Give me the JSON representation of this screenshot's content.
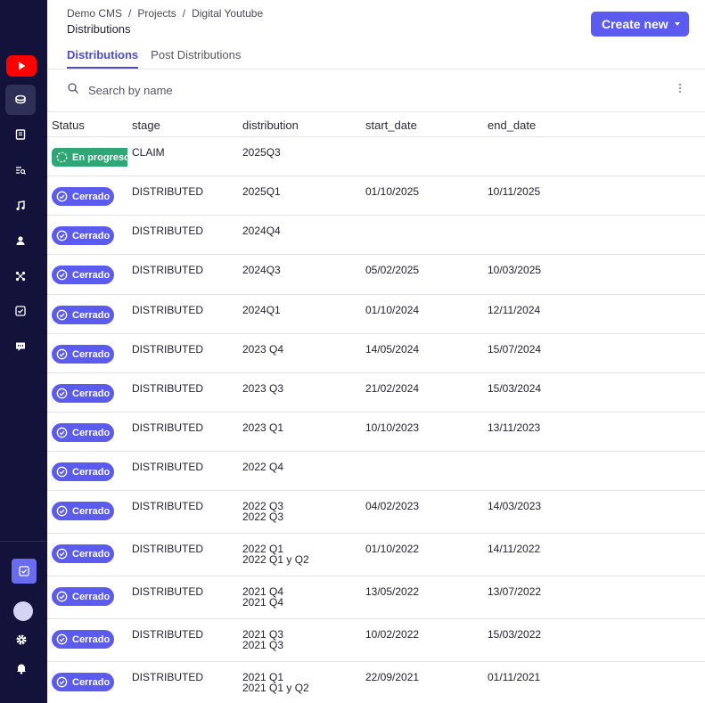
{
  "breadcrumb": [
    "Demo CMS",
    "/",
    "Projects",
    "/",
    "Digital Youtube"
  ],
  "page_title": "Distributions",
  "create_button": "Create new",
  "tabs": [
    "Distributions",
    "Post Distributions"
  ],
  "search": {
    "placeholder": "Search by name",
    "value": ""
  },
  "sidebar": {
    "icons": [
      "youtube-logo-icon",
      "coins-icon",
      "book-icon",
      "list-search-icon",
      "music-icon",
      "user-icon",
      "network-icon",
      "checkbox-icon",
      "chat-icon"
    ],
    "bottom": [
      "checkbox-icon",
      "avatar",
      "gear-icon",
      "bell-icon"
    ]
  },
  "colors": {
    "sidebar": "#12123a",
    "accent": "#5b5bf0",
    "in_progress": "#2ea675"
  },
  "columns": [
    "Status",
    "stage",
    "distribution",
    "start_date",
    "end_date"
  ],
  "rows": [
    {
      "status": "En progreso",
      "stage": "CLAIM",
      "distribution": "2025Q3",
      "start_date": "",
      "end_date": ""
    },
    {
      "status": "Cerrado",
      "stage": "DISTRIBUTED",
      "distribution": "2025Q1",
      "start_date": "01/10/2025",
      "end_date": "10/11/2025"
    },
    {
      "status": "Cerrado",
      "stage": "DISTRIBUTED",
      "distribution": "2024Q4",
      "start_date": "",
      "end_date": ""
    },
    {
      "status": "Cerrado",
      "stage": "DISTRIBUTED",
      "distribution": "2024Q3",
      "start_date": "05/02/2025",
      "end_date": "10/03/2025"
    },
    {
      "status": "Cerrado",
      "stage": "DISTRIBUTED",
      "distribution": "2024Q1",
      "start_date": "01/10/2024",
      "end_date": "12/11/2024"
    },
    {
      "status": "Cerrado",
      "stage": "DISTRIBUTED",
      "distribution": "2023 Q4",
      "start_date": "14/05/2024",
      "end_date": "15/07/2024"
    },
    {
      "status": "Cerrado",
      "stage": "DISTRIBUTED",
      "distribution": "2023 Q3",
      "start_date": "21/02/2024",
      "end_date": "15/03/2024"
    },
    {
      "status": "Cerrado",
      "stage": "DISTRIBUTED",
      "distribution": "2023 Q1",
      "start_date": "10/10/2023",
      "end_date": "13/11/2023"
    },
    {
      "status": "Cerrado",
      "stage": "DISTRIBUTED",
      "distribution": "2022 Q4",
      "start_date": "",
      "end_date": ""
    },
    {
      "status": "Cerrado",
      "stage": "DISTRIBUTED",
      "distribution": "2022 Q3\n2022 Q3",
      "start_date": "04/02/2023",
      "end_date": "14/03/2023"
    },
    {
      "status": "Cerrado",
      "stage": "DISTRIBUTED",
      "distribution": "2022 Q1\n2022 Q1 y Q2",
      "start_date": "01/10/2022",
      "end_date": "14/11/2022"
    },
    {
      "status": "Cerrado",
      "stage": "DISTRIBUTED",
      "distribution": "2021 Q4\n2021 Q4",
      "start_date": "13/05/2022",
      "end_date": "13/07/2022"
    },
    {
      "status": "Cerrado",
      "stage": "DISTRIBUTED",
      "distribution": "2021 Q3\n2021 Q3",
      "start_date": "10/02/2022",
      "end_date": "15/03/2022"
    },
    {
      "status": "Cerrado",
      "stage": "DISTRIBUTED",
      "distribution": "2021 Q1\n2021 Q1 y Q2",
      "start_date": "22/09/2021",
      "end_date": "01/11/2021"
    }
  ]
}
